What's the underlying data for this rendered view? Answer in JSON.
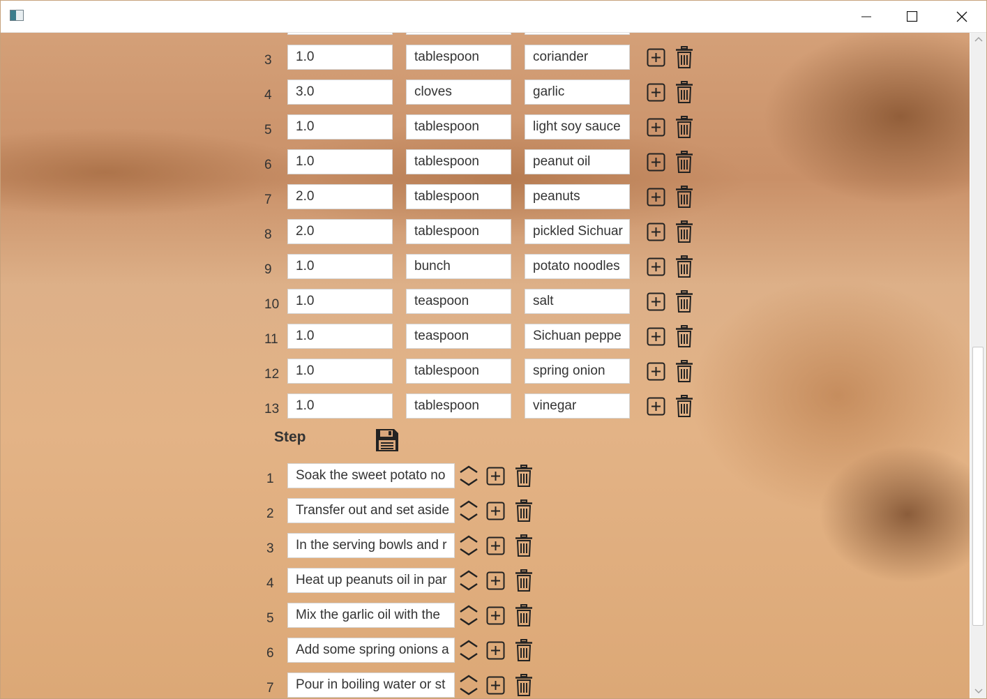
{
  "ingredients": [
    {
      "index": "3",
      "quantity": "1.0",
      "unit": "tablespoon",
      "name": "coriander"
    },
    {
      "index": "4",
      "quantity": "3.0",
      "unit": "cloves",
      "name": "garlic"
    },
    {
      "index": "5",
      "quantity": "1.0",
      "unit": "tablespoon",
      "name": "light soy sauce"
    },
    {
      "index": "6",
      "quantity": "1.0",
      "unit": "tablespoon",
      "name": "peanut oil"
    },
    {
      "index": "7",
      "quantity": "2.0",
      "unit": "tablespoon",
      "name": "peanuts"
    },
    {
      "index": "8",
      "quantity": "2.0",
      "unit": "tablespoon",
      "name": "pickled Sichuar"
    },
    {
      "index": "9",
      "quantity": "1.0",
      "unit": "bunch",
      "name": "potato noodles"
    },
    {
      "index": "10",
      "quantity": "1.0",
      "unit": "teaspoon",
      "name": "salt"
    },
    {
      "index": "11",
      "quantity": "1.0",
      "unit": "teaspoon",
      "name": "Sichuan peppe"
    },
    {
      "index": "12",
      "quantity": "1.0",
      "unit": "tablespoon",
      "name": "spring onion"
    },
    {
      "index": "13",
      "quantity": "1.0",
      "unit": "tablespoon",
      "name": "vinegar"
    }
  ],
  "step_section": {
    "label": "Step"
  },
  "steps": [
    {
      "index": "1",
      "text": "Soak the sweet potato no"
    },
    {
      "index": "2",
      "text": "Transfer out and set aside"
    },
    {
      "index": "3",
      "text": "In the serving bowls and r"
    },
    {
      "index": "4",
      "text": "Heat up peanuts oil in par"
    },
    {
      "index": "5",
      "text": "Mix the garlic oil with the"
    },
    {
      "index": "6",
      "text": "Add some spring onions a"
    },
    {
      "index": "7",
      "text": "Pour in boiling water or st"
    }
  ],
  "icons": {
    "add": "plus-square-icon",
    "delete": "trash-icon",
    "reorder": "up-down-chevron-icon",
    "save": "floppy-disk-icon"
  }
}
